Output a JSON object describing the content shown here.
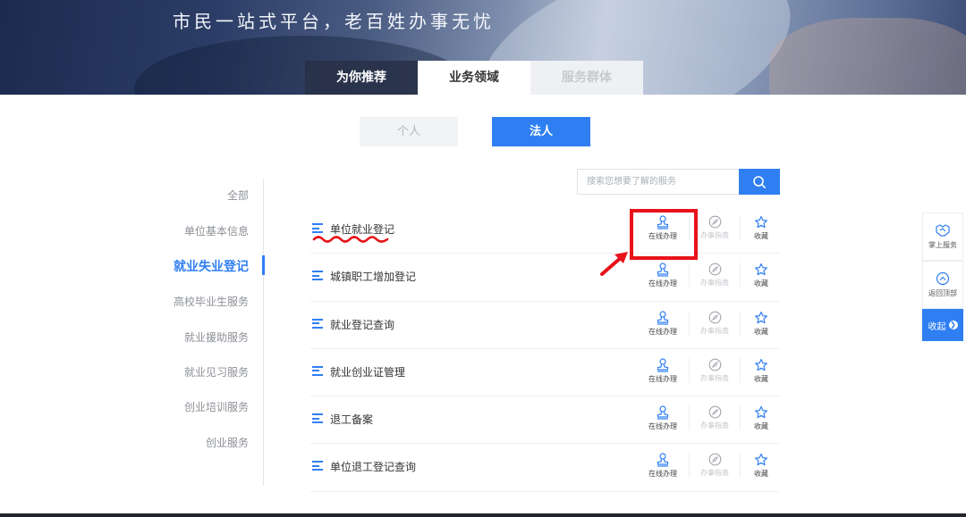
{
  "banner": {
    "slogan": "市民一站式平台，老百姓办事无忧",
    "tabs": [
      {
        "label": "为你推荐",
        "state": "dark"
      },
      {
        "label": "业务领域",
        "state": "active"
      },
      {
        "label": "服务群体",
        "state": "disabled"
      }
    ]
  },
  "persona": {
    "individual_label": "个人",
    "legal_label": "法人",
    "selected": "法人"
  },
  "search": {
    "placeholder": "搜索您想要了解的服务"
  },
  "sidebar": {
    "items": [
      {
        "label": "全部",
        "active": false
      },
      {
        "label": "单位基本信息",
        "active": false
      },
      {
        "label": "就业失业登记",
        "active": true
      },
      {
        "label": "高校毕业生服务",
        "active": false
      },
      {
        "label": "就业援助服务",
        "active": false
      },
      {
        "label": "就业见习服务",
        "active": false
      },
      {
        "label": "创业培训服务",
        "active": false
      },
      {
        "label": "创业服务",
        "active": false
      }
    ]
  },
  "services": {
    "actions": {
      "online": "在线办理",
      "guide": "办事指南",
      "favorite": "收藏"
    },
    "items": [
      {
        "title": "单位就业登记"
      },
      {
        "title": "城镇职工增加登记"
      },
      {
        "title": "就业登记查询"
      },
      {
        "title": "就业创业证管理"
      },
      {
        "title": "退工备案"
      },
      {
        "title": "单位退工登记查询"
      }
    ]
  },
  "float_panel": {
    "mobile_service": "掌上服务",
    "back_to_top": "返回顶部",
    "collapse": "收起",
    "collapse_glyph": "❯"
  },
  "colors": {
    "accent": "#2f7ff2",
    "annotation_red": "#e8121a"
  }
}
